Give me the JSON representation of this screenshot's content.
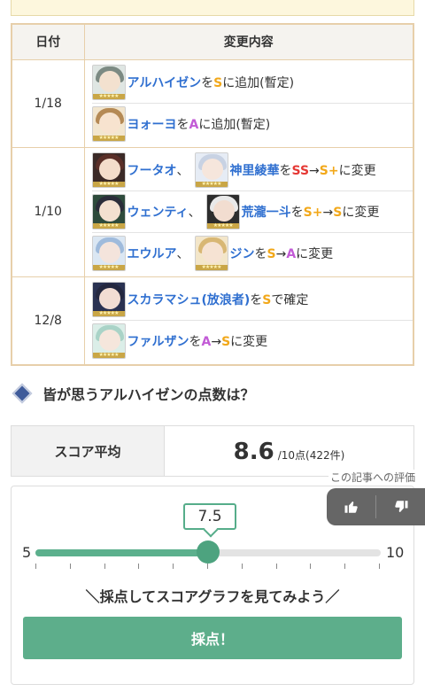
{
  "table": {
    "header_date": "日付",
    "header_content": "変更内容",
    "groups": [
      {
        "date": "1/18",
        "entries": [
          {
            "avatar": "alhaitham-icon",
            "parts": [
              {
                "t": "アルハイゼン",
                "c": "name"
              },
              {
                "t": "を",
                "c": ""
              },
              {
                "t": "S",
                "c": "S"
              },
              {
                "t": "に追加(暫定)",
                "c": ""
              }
            ]
          },
          {
            "avatar": "yaoyao-icon",
            "parts": [
              {
                "t": "ヨォーヨ",
                "c": "name"
              },
              {
                "t": "を",
                "c": ""
              },
              {
                "t": "A",
                "c": "A"
              },
              {
                "t": "に追加(暫定)",
                "c": ""
              }
            ]
          }
        ]
      },
      {
        "date": "1/10",
        "entries": [
          {
            "avatar": "hutao-icon",
            "avatar2": "ayaka-icon",
            "parts": [
              {
                "t": "フータオ",
                "c": "name"
              },
              {
                "t": "、",
                "c": ""
              }
            ],
            "parts2": [
              {
                "t": "神里綾華",
                "c": "name"
              },
              {
                "t": "を",
                "c": ""
              },
              {
                "t": "SS",
                "c": "SS"
              },
              {
                "t": "→",
                "c": ""
              },
              {
                "t": "S+",
                "c": "Splus"
              },
              {
                "t": "に変更",
                "c": ""
              }
            ]
          },
          {
            "avatar": "venti-icon",
            "avatar2": "itto-icon",
            "parts": [
              {
                "t": "ウェンティ",
                "c": "name"
              },
              {
                "t": "、",
                "c": ""
              }
            ],
            "parts2": [
              {
                "t": "荒瀧一斗",
                "c": "name"
              },
              {
                "t": "を",
                "c": ""
              },
              {
                "t": "S+",
                "c": "Splus"
              },
              {
                "t": "→",
                "c": ""
              },
              {
                "t": "S",
                "c": "S"
              },
              {
                "t": "に変更",
                "c": ""
              }
            ]
          },
          {
            "avatar": "eula-icon",
            "avatar2": "jean-icon",
            "parts": [
              {
                "t": "エウルア",
                "c": "name"
              },
              {
                "t": "、",
                "c": ""
              }
            ],
            "parts2": [
              {
                "t": "ジン",
                "c": "name"
              },
              {
                "t": "を",
                "c": ""
              },
              {
                "t": "S",
                "c": "S"
              },
              {
                "t": "→",
                "c": ""
              },
              {
                "t": "A",
                "c": "A"
              },
              {
                "t": "に変更",
                "c": ""
              }
            ]
          }
        ]
      },
      {
        "date": "12/8",
        "entries": [
          {
            "avatar": "scaramouche-icon",
            "parts": [
              {
                "t": "スカラマシュ(放浪者)",
                "c": "name"
              },
              {
                "t": "を",
                "c": ""
              },
              {
                "t": "S",
                "c": "S"
              },
              {
                "t": "で確定",
                "c": ""
              }
            ]
          },
          {
            "avatar": "faruzan-icon",
            "parts": [
              {
                "t": "ファルザン",
                "c": "name"
              },
              {
                "t": "を",
                "c": ""
              },
              {
                "t": "A",
                "c": "A"
              },
              {
                "t": "→",
                "c": ""
              },
              {
                "t": "S",
                "c": "S"
              },
              {
                "t": "に変更",
                "c": ""
              }
            ]
          }
        ]
      }
    ]
  },
  "section": {
    "title": "皆が思うアルハイゼンの点数は？",
    "icon": "diamond-icon"
  },
  "score": {
    "label": "スコア平均",
    "value": "8.6",
    "suffix": "/10点(422件)"
  },
  "feedback": {
    "label": "この記事への評価",
    "like_icon": "thumbs-up-icon",
    "dislike_icon": "thumbs-down-icon"
  },
  "slider": {
    "min": "5",
    "max": "10",
    "current": "7.5",
    "fraction": 0.5,
    "tick_count": 11
  },
  "cta": {
    "text": "＼採点してスコアグラフを見てみよう／",
    "button": "採点！"
  },
  "colors": {
    "accent": "#5dae8b",
    "name": "#2f6fd0",
    "rank_s": "#f2a81a",
    "rank_a": "#c25bd6",
    "rank_ss": "#e53935"
  }
}
